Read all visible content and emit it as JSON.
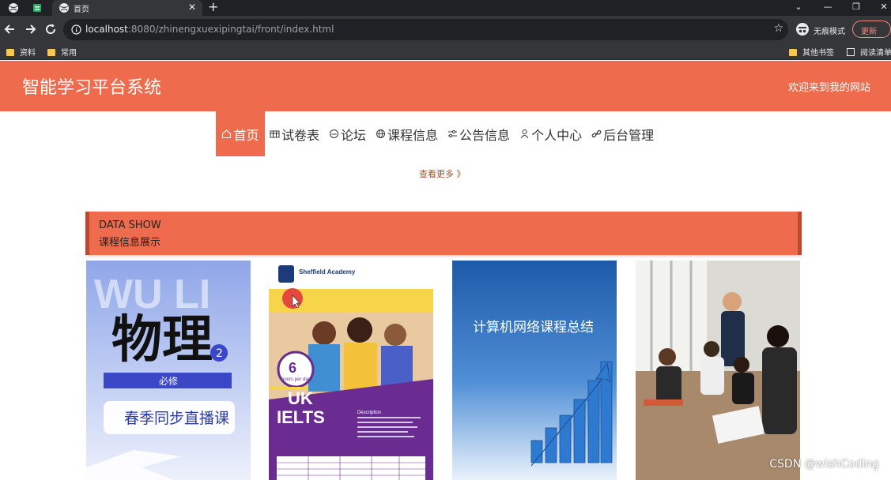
{
  "browser": {
    "tab": {
      "title": "首页"
    },
    "address": {
      "host": "localhost",
      "rest": ":8080/zhinengxuexipingtai/front/index.html"
    },
    "incognito_label": "无痕模式",
    "update_label": "更新",
    "bookmarks": [
      {
        "label": "资料"
      },
      {
        "label": "常用"
      }
    ],
    "bookmarks_right": [
      {
        "label": "其他书签"
      },
      {
        "label": "阅读清单"
      }
    ]
  },
  "header": {
    "title": "智能学习平台系统",
    "welcome": "欢迎来到我的网站"
  },
  "nav": [
    {
      "label": "首页",
      "icon": "home-icon",
      "active": true
    },
    {
      "label": "试卷表",
      "icon": "table-icon",
      "active": false
    },
    {
      "label": "论坛",
      "icon": "forum-icon",
      "active": false
    },
    {
      "label": "课程信息",
      "icon": "globe-icon",
      "active": false
    },
    {
      "label": "公告信息",
      "icon": "filter-icon",
      "active": false
    },
    {
      "label": "个人中心",
      "icon": "user-icon",
      "active": false
    },
    {
      "label": "后台管理",
      "icon": "link-icon",
      "active": false
    }
  ],
  "more_link": "查看更多 》",
  "section": {
    "title_en": "DATA SHOW",
    "title_cn": "课程信息展示"
  },
  "cards": [
    {
      "name": "physics",
      "bg_text": "WU LI",
      "main_text": "物理",
      "badge": "2",
      "tag": "必修",
      "banner": "春季同步直播课"
    },
    {
      "name": "ielts",
      "school_name": "Sheffield Academy",
      "badge_top": "6",
      "badge_sub": "hours per day",
      "line1": "UK",
      "line2": "IELTS",
      "desc_title": "Description"
    },
    {
      "name": "network",
      "text": "计算机网络课程总结"
    },
    {
      "name": "classroom"
    }
  ],
  "watermark": "CSDN @wishCoding",
  "colors": {
    "accent": "#ee6b4d",
    "accent_dark": "#b84a30"
  }
}
